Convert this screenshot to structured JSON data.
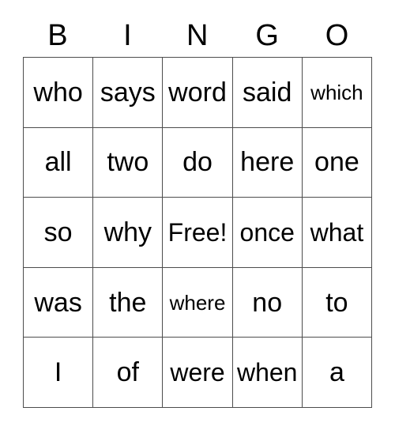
{
  "card": {
    "title": "BINGO",
    "header_letters": [
      "B",
      "I",
      "N",
      "G",
      "O"
    ],
    "free_space_label": "Free!",
    "colors": {
      "background": "#ffffff",
      "text": "#000000",
      "grid_line": "#4d4d4d"
    },
    "rows": [
      [
        {
          "text": "who",
          "size": "normal"
        },
        {
          "text": "says",
          "size": "normal"
        },
        {
          "text": "word",
          "size": "normal"
        },
        {
          "text": "said",
          "size": "normal"
        },
        {
          "text": "which",
          "size": "small"
        }
      ],
      [
        {
          "text": "all",
          "size": "normal"
        },
        {
          "text": "two",
          "size": "normal"
        },
        {
          "text": "do",
          "size": "normal"
        },
        {
          "text": "here",
          "size": "normal"
        },
        {
          "text": "one",
          "size": "normal"
        }
      ],
      [
        {
          "text": "so",
          "size": "normal"
        },
        {
          "text": "why",
          "size": "normal"
        },
        {
          "text": "Free!",
          "size": "fit"
        },
        {
          "text": "once",
          "size": "fit"
        },
        {
          "text": "what",
          "size": "fit"
        }
      ],
      [
        {
          "text": "was",
          "size": "normal"
        },
        {
          "text": "the",
          "size": "normal"
        },
        {
          "text": "where",
          "size": "small"
        },
        {
          "text": "no",
          "size": "normal"
        },
        {
          "text": "to",
          "size": "normal"
        }
      ],
      [
        {
          "text": "I",
          "size": "normal"
        },
        {
          "text": "of",
          "size": "normal"
        },
        {
          "text": "were",
          "size": "fit"
        },
        {
          "text": "when",
          "size": "fit"
        },
        {
          "text": "a",
          "size": "normal"
        }
      ]
    ]
  }
}
